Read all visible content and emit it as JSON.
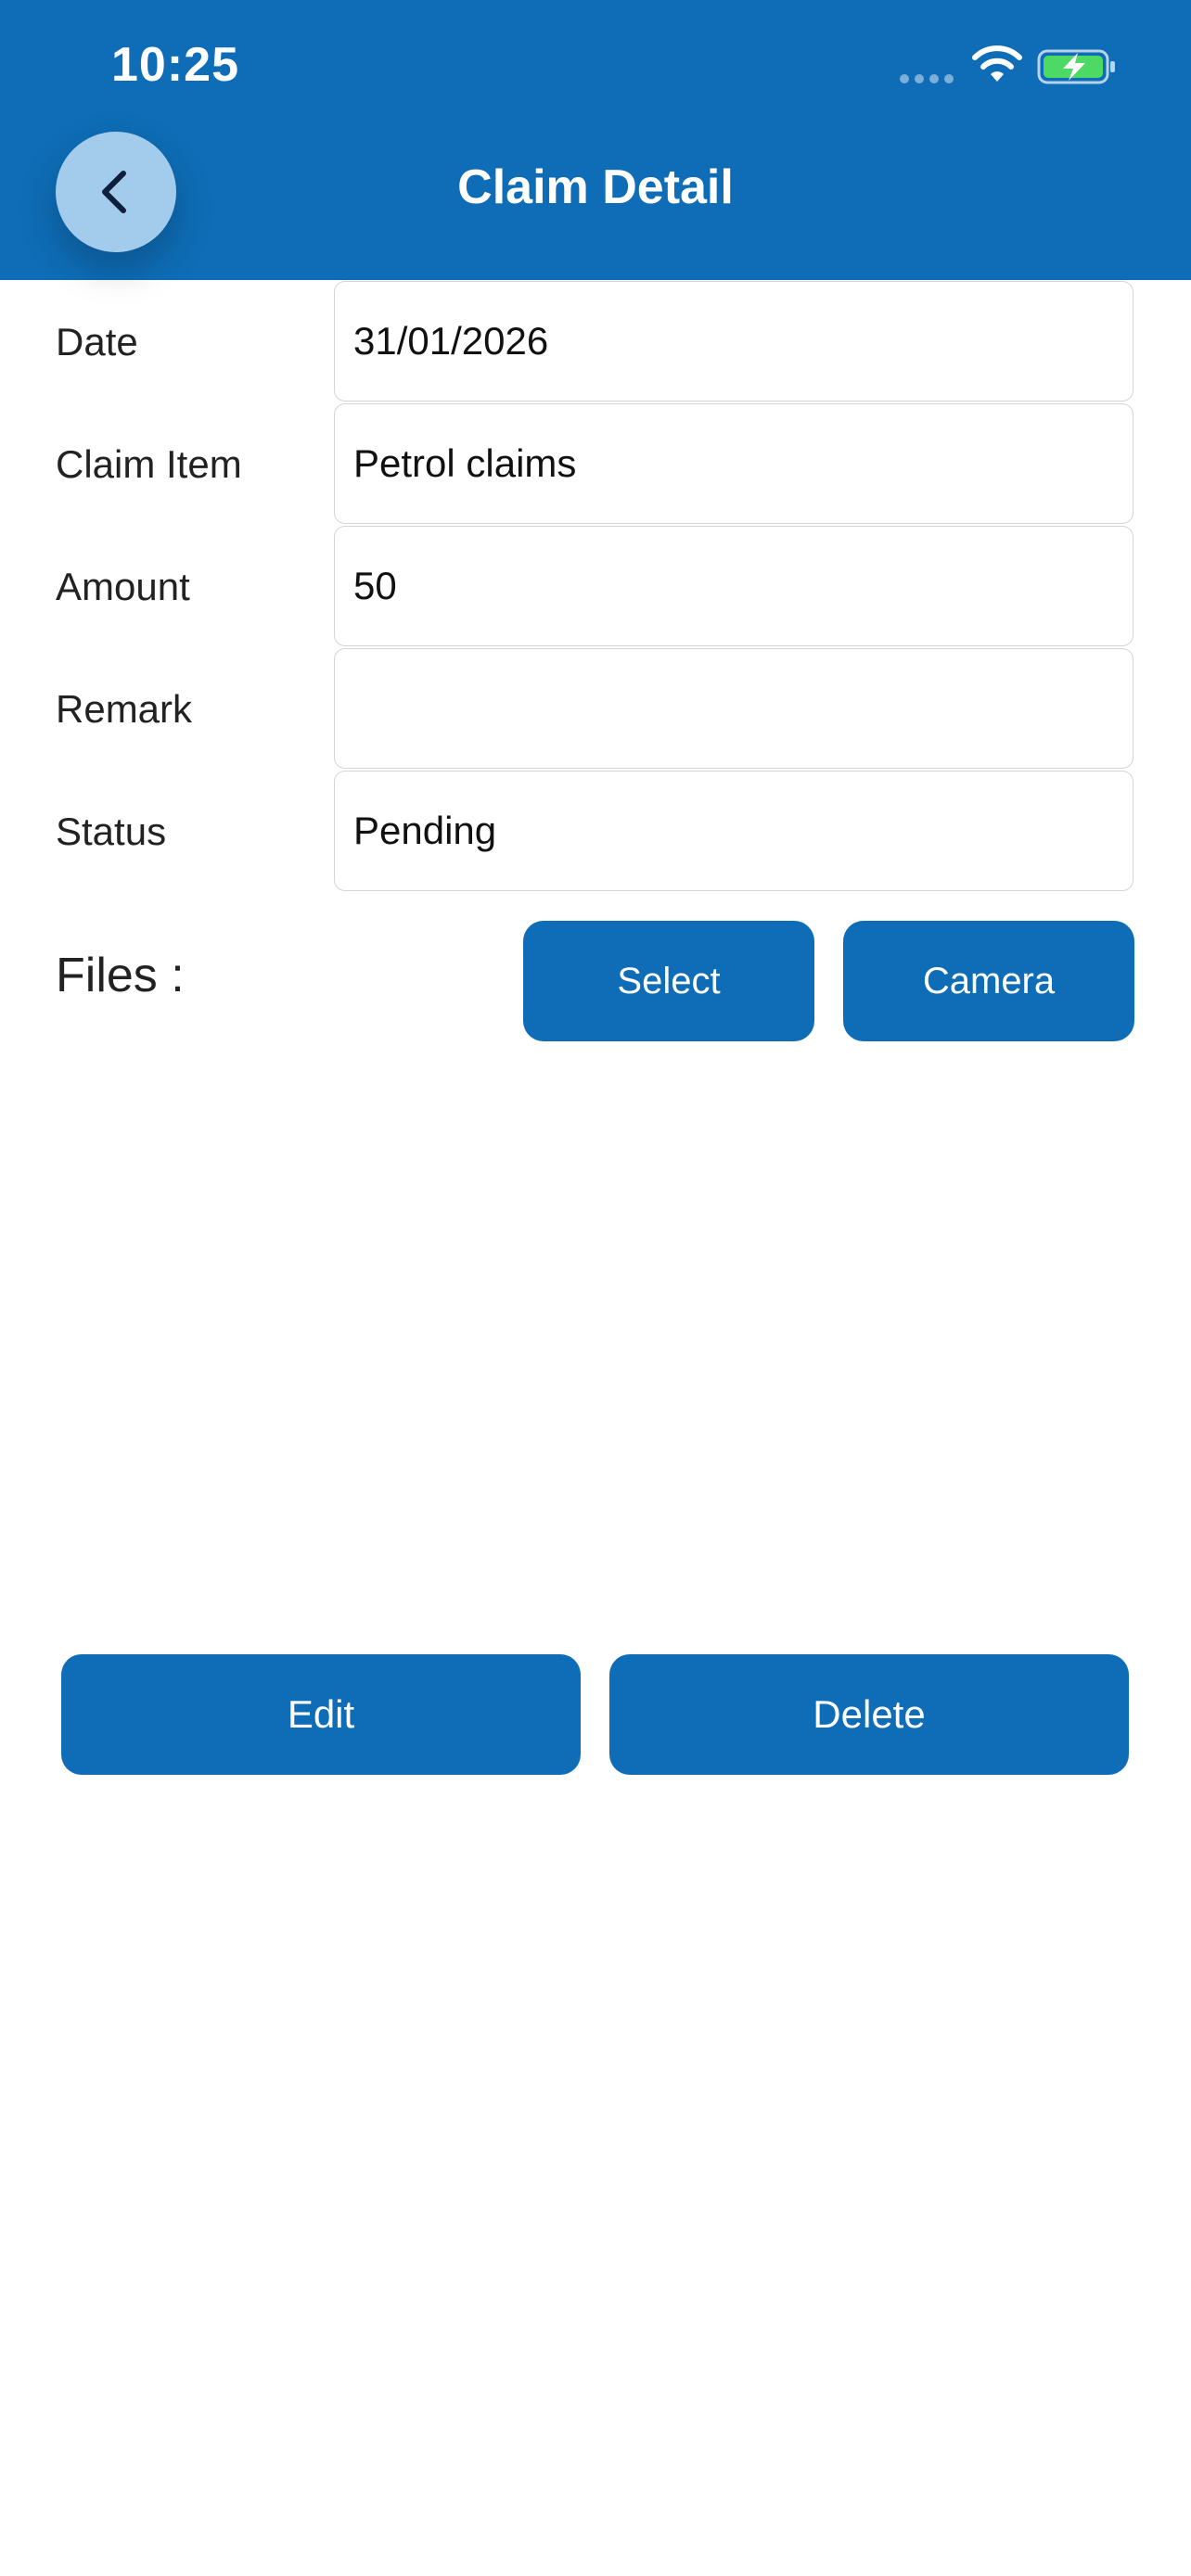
{
  "status_bar": {
    "time": "10:25"
  },
  "header": {
    "title": "Claim Detail",
    "back_icon": "chevron-left-icon",
    "color": "#0e6db6"
  },
  "form": {
    "date": {
      "label": "Date",
      "value": "31/01/2026"
    },
    "claim_item": {
      "label": "Claim Item",
      "value": "Petrol claims"
    },
    "amount": {
      "label": "Amount",
      "value": "50"
    },
    "remark": {
      "label": "Remark",
      "value": ""
    },
    "status": {
      "label": "Status",
      "value": "Pending"
    }
  },
  "files": {
    "label": "Files :",
    "select_label": "Select",
    "camera_label": "Camera"
  },
  "actions": {
    "edit_label": "Edit",
    "delete_label": "Delete"
  }
}
